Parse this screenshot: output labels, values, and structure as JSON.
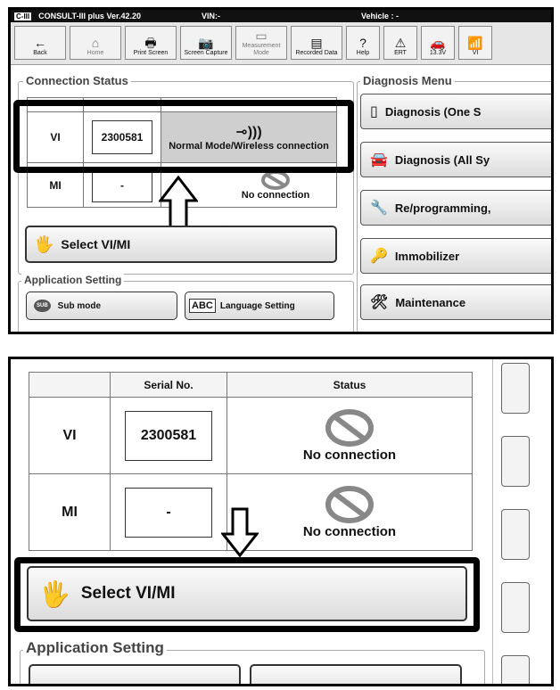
{
  "top": {
    "titlebar": {
      "app": "CONSULT-III plus  Ver.42.20",
      "vin": "VIN:-",
      "vehicle": "Vehicle : -"
    },
    "toolbar": [
      {
        "label": "Back",
        "icon": "←"
      },
      {
        "label": "Home",
        "icon": "⌂"
      },
      {
        "label": "Print Screen",
        "icon": "🖶"
      },
      {
        "label": "Screen Capture",
        "icon": "📷"
      },
      {
        "label": "Measurement Mode",
        "icon": "▭"
      },
      {
        "label": "Recorded Data",
        "icon": "▤"
      },
      {
        "label": "Help",
        "icon": "?"
      },
      {
        "label": "ERT",
        "icon": "⚠"
      },
      {
        "label": "13.3V",
        "icon": "🚗"
      },
      {
        "label": "VI",
        "icon": "📶"
      }
    ],
    "connection_status": {
      "title": "Connection Status",
      "vi": {
        "label": "VI",
        "serial": "2300581",
        "status": "Normal Mode/Wireless connection"
      },
      "mi": {
        "label": "MI",
        "serial": "-",
        "status": "No connection"
      },
      "select_label": "Select VI/MI"
    },
    "application_setting": {
      "title": "Application Setting",
      "sub_mode": "Sub mode",
      "language": "Language Setting",
      "sub_icon": "SUB",
      "lang_icon": "ABC"
    },
    "diagnosis_menu": {
      "title": "Diagnosis Menu",
      "items": [
        "Diagnosis (One S",
        "Diagnosis (All Sy",
        "Re/programming,",
        "Immobilizer",
        "Maintenance"
      ]
    }
  },
  "bottom": {
    "headers": {
      "serial": "Serial No.",
      "status": "Status"
    },
    "vi": {
      "label": "VI",
      "serial": "2300581",
      "status": "No connection"
    },
    "mi": {
      "label": "MI",
      "serial": "-",
      "status": "No connection"
    },
    "select_label": "Select VI/MI",
    "application_setting": "Application Setting"
  }
}
